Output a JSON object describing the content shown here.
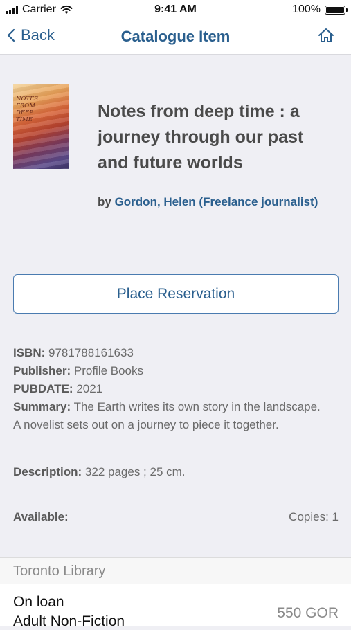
{
  "status_bar": {
    "carrier": "Carrier",
    "time": "9:41 AM",
    "battery_percent": "100%",
    "battery_level": 1.0
  },
  "nav": {
    "back_label": "Back",
    "title": "Catalogue Item",
    "home_icon": "home-icon"
  },
  "item": {
    "cover_lines": [
      "NOTES",
      "FROM",
      "DEEP",
      "TIME"
    ],
    "title": "Notes from deep time : a journey through our past and future worlds",
    "by_label": "by",
    "author": "Gordon, Helen (Freelance journalist)",
    "reserve_label": "Place Reservation",
    "isbn_label": "ISBN:",
    "isbn": "9781788161633",
    "publisher_label": "Publisher:",
    "publisher": "Profile Books",
    "pubdate_label": "PUBDATE:",
    "pubdate": "2021",
    "summary_label": "Summary:",
    "summary": "The Earth writes its own story in the landscape. A novelist sets out on a journey to piece it together.",
    "description_label": "Description:",
    "description": "322 pages ; 25 cm.",
    "available_label": "Available:",
    "copies": "Copies: 1"
  },
  "holdings": {
    "library": "Toronto Library",
    "items": [
      {
        "status": "On loan",
        "collection": "Adult Non-Fiction",
        "call_number": "550 GOR"
      }
    ]
  },
  "colors": {
    "accent": "#2a5f8e",
    "background": "#efeff4",
    "button_border": "#4a7bb0"
  }
}
